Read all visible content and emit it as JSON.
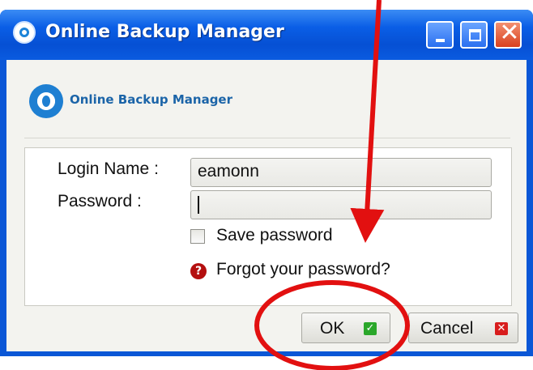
{
  "window": {
    "title": "Online Backup Manager",
    "controls": {
      "minimize_icon": "minimize-icon",
      "maximize_icon": "maximize-icon",
      "close_icon": "close-icon"
    }
  },
  "header": {
    "app_name": "Online Backup Manager"
  },
  "form": {
    "login_label": "Login Name :",
    "login_value": "eamonn",
    "password_label": "Password :",
    "password_value": "",
    "save_password_label": "Save password",
    "save_password_checked": false,
    "forgot_label": "Forgot your password?"
  },
  "buttons": {
    "ok_label": "OK",
    "cancel_label": "Cancel"
  },
  "annotation": {
    "color": "#e21010"
  }
}
